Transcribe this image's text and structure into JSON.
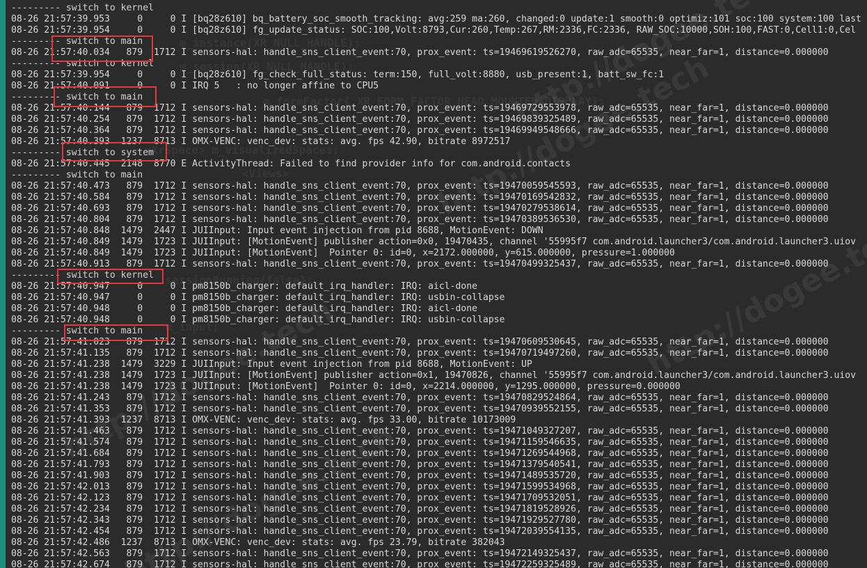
{
  "watermark_text": "http://dogee.tech",
  "code_ghost": [
    "m_instance(XR_NULL_HANDLE);",
    "m_session(XR_NULL_HANDLE);",
    "m_formFactor{ XR_FORM_FACTOR_HEAD_MOUNTED_DISPLAY};",
    "<XrSpace> m_visualizedSpaces;",
    "<Views>",
    "sessionRunning{false};",
    "m_input;"
  ],
  "log_lines": [
    "--------- switch to kernel",
    "08-26 21:57:39.953     0     0 I [bq28z610] bq_battery_soc_smooth_tracking: avg:259 ma:260, changed:0 update:1 smooth:0 optimiz:101 soc:100 system:100 last",
    "08-26 21:57:39.954     0     0 I [bq28z610] fg_update_status: SOC:100,Volt:8793,Cur:260,Temp:267,RM:2336,FC:2336, RAW_SOC:10000,SOH:100,FAST:0,Cell1:0,Cel",
    "--------- switch to main",
    "08-26 21:57:40.034   879  1712 I sensors-hal: handle_sns_client_event:70, prox_event: ts=19469619526270, raw_adc=65535, near_far=1, distance=0.000000",
    "--------- switch to kernel",
    "08-26 21:57:39.954     0     0 I [bq28z610] fg_check_full_status: term:150, full_volt:8880, usb_present:1, batt_sw_fc:1",
    "08-26 21:57:40.091     0     0 I IRQ 5   : no longer affine to CPU5",
    "--------- switch to main",
    "08-26 21:57:40.144   879  1712 I sensors-hal: handle_sns_client_event:70, prox_event: ts=19469729553978, raw_adc=65535, near_far=1, distance=0.000000",
    "08-26 21:57:40.254   879  1712 I sensors-hal: handle_sns_client_event:70, prox_event: ts=19469839325489, raw_adc=65535, near_far=1, distance=0.000000",
    "08-26 21:57:40.364   879  1712 I sensors-hal: handle_sns_client_event:70, prox_event: ts=19469949548666, raw_adc=65535, near_far=1, distance=0.000000",
    "08-26 21:57:40.393  1237  8713 I OMX-VENC: venc_dev: stats: avg. fps 42.90, bitrate 8972517",
    "--------- switch to system",
    "08-26 21:57:40.445  2148  8770 E ActivityThread: Failed to find provider info for com.android.contacts",
    "--------- switch to main",
    "08-26 21:57:40.473   879  1712 I sensors-hal: handle_sns_client_event:70, prox_event: ts=19470059545593, raw_adc=65535, near_far=1, distance=0.000000",
    "08-26 21:57:40.584   879  1712 I sensors-hal: handle_sns_client_event:70, prox_event: ts=19470169542832, raw_adc=65535, near_far=1, distance=0.000000",
    "08-26 21:57:40.693   879  1712 I sensors-hal: handle_sns_client_event:70, prox_event: ts=19470279538614, raw_adc=65535, near_far=1, distance=0.000000",
    "08-26 21:57:40.804   879  1712 I sensors-hal: handle_sns_client_event:70, prox_event: ts=19470389536530, raw_adc=65535, near_far=1, distance=0.000000",
    "08-26 21:57:40.848  1479  2447 I JUIInput: Input event injection from pid 8688, MotionEvent: DOWN",
    "08-26 21:57:40.849  1479  1723 I JUIInput: [MotionEvent] publisher action=0x0, 19470435, channel '55995f7 com.android.launcher3/com.android.launcher3.uiov",
    "08-26 21:57:40.849  1479  1723 I JUIInput: [MotionEvent]  Pointer 0: id=0, x=2172.000000, y=615.000000, pressure=1.000000",
    "08-26 21:57:40.913   879  1712 I sensors-hal: handle_sns_client_event:70, prox_event: ts=19470499325437, raw_adc=65535, near_far=1, distance=0.000000",
    "--------- switch to kernel",
    "08-26 21:57:40.947     0     0 I pm8150b_charger: default_irq_handler: IRQ: aicl-done",
    "08-26 21:57:40.947     0     0 I pm8150b_charger: default_irq_handler: IRQ: usbin-collapse",
    "08-26 21:57:40.948     0     0 I pm8150b_charger: default_irq_handler: IRQ: aicl-done",
    "08-26 21:57:40.948     0     0 I pm8150b_charger: default_irq_handler: IRQ: usbin-collapse",
    "--------- switch to main",
    "08-26 21:57:41.023   879  1712 I sensors-hal: handle_sns_client_event:70, prox_event: ts=19470609530645, raw_adc=65535, near_far=1, distance=0.000000",
    "08-26 21:57:41.135   879  1712 I sensors-hal: handle_sns_client_event:70, prox_event: ts=19470719497260, raw_adc=65535, near_far=1, distance=0.000000",
    "08-26 21:57:41.238  1479  3229 I JUIInput: Input event injection from pid 8688, MotionEvent: UP",
    "08-26 21:57:41.238  1479  1723 I JUIInput: [MotionEvent] publisher action=0x1, 19470826, channel '55995f7 com.android.launcher3/com.android.launcher3.uiov",
    "08-26 21:57:41.238  1479  1723 I JUIInput: [MotionEvent]  Pointer 0: id=0, x=2214.000000, y=1295.000000, pressure=0.000000",
    "08-26 21:57:41.243   879  1712 I sensors-hal: handle_sns_client_event:70, prox_event: ts=19470829524864, raw_adc=65535, near_far=1, distance=0.000000",
    "08-26 21:57:41.353   879  1712 I sensors-hal: handle_sns_client_event:70, prox_event: ts=19470939552155, raw_adc=65535, near_far=1, distance=0.000000",
    "08-26 21:57:41.393  1237  8713 I OMX-VENC: venc_dev: stats: avg. fps 33.00, bitrate 10173009",
    "08-26 21:57:41.463   879  1712 I sensors-hal: handle_sns_client_event:70, prox_event: ts=19471049327207, raw_adc=65535, near_far=1, distance=0.000000",
    "08-26 21:57:41.574   879  1712 I sensors-hal: handle_sns_client_event:70, prox_event: ts=19471159546635, raw_adc=65535, near_far=1, distance=0.000000",
    "08-26 21:57:41.684   879  1712 I sensors-hal: handle_sns_client_event:70, prox_event: ts=19471269544968, raw_adc=65535, near_far=1, distance=0.000000",
    "08-26 21:57:41.793   879  1712 I sensors-hal: handle_sns_client_event:70, prox_event: ts=19471379540541, raw_adc=65535, near_far=1, distance=0.000000",
    "08-26 21:57:41.903   879  1712 I sensors-hal: handle_sns_client_event:70, prox_event: ts=19471489535720, raw_adc=65535, near_far=1, distance=0.000000",
    "08-26 21:57:42.013   879  1712 I sensors-hal: handle_sns_client_event:70, prox_event: ts=19471599534968, raw_adc=65535, near_far=1, distance=0.000000",
    "08-26 21:57:42.123   879  1712 I sensors-hal: handle_sns_client_event:70, prox_event: ts=19471709532051, raw_adc=65535, near_far=1, distance=0.000000",
    "08-26 21:57:42.234   879  1712 I sensors-hal: handle_sns_client_event:70, prox_event: ts=19471819528926, raw_adc=65535, near_far=1, distance=0.000000",
    "08-26 21:57:42.343   879  1712 I sensors-hal: handle_sns_client_event:70, prox_event: ts=19471929527780, raw_adc=65535, near_far=1, distance=0.000000",
    "08-26 21:57:42.454   879  1712 I sensors-hal: handle_sns_client_event:70, prox_event: ts=19472039554135, raw_adc=65535, near_far=1, distance=0.000000",
    "08-26 21:57:42.486  1237  8713 I OMX-VENC: venc_dev: stats: avg. fps 23.79, bitrate 382043",
    "08-26 21:57:42.563   879  1712 I sensors-hal: handle_sns_client_event:70, prox_event: ts=19472149325437, raw_adc=65535, near_far=1, distance=0.000000",
    "08-26 21:57:42.674   879  1712 I sensors-hal: handle_sns_client_event:70, prox_event: ts=19472259325489, raw_adc=65535, near_far=1, distance=0.000000"
  ],
  "colors": {
    "terminal_bg": "#2b2b2b",
    "text": "#d8d8d8",
    "highlight_box": "#e2393a",
    "frame": "#1e8f7e"
  }
}
